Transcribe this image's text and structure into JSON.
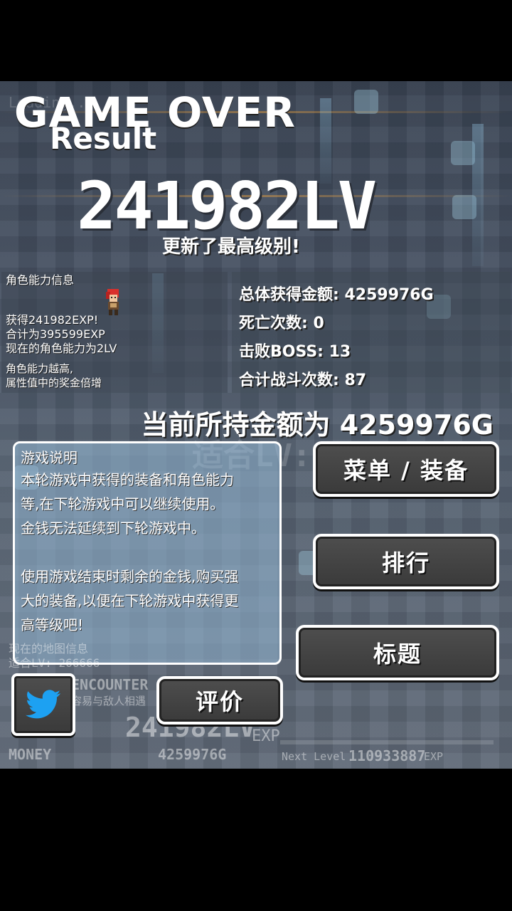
{
  "header": {
    "game_over": "GAME OVER",
    "result": "Result",
    "level": "241982LV",
    "level_message": "更新了最高级别!"
  },
  "character_panel": {
    "title": "角色能力信息",
    "lines": [
      "获得241982EXP!",
      "合计为395599EXP",
      "现在的角色能力为2LV"
    ],
    "note_lines": [
      "角色能力越高,",
      "属性值中的奖金倍增"
    ]
  },
  "stats": {
    "total_gold": "总体获得金额: 4259976G",
    "deaths": "死亡次数: 0",
    "bosses": "击败BOSS: 13",
    "battles": "合计战斗次数: 87"
  },
  "money_line": "当前所持金额为 4259976G",
  "info_box": {
    "title": "游戏说明",
    "lines": [
      "本轮游戏中获得的装备和角色能力",
      "等,在下轮游戏中可以继续使用。",
      "金钱无法延续到下轮游戏中。",
      "",
      "使用游戏结束时剩余的金钱,购买强",
      "大的装备,以便在下轮游戏中获得更",
      "高等级吧!"
    ]
  },
  "buttons": {
    "menu": "菜单 / 装备",
    "ranking": "排行",
    "title": "标题",
    "review": "评价"
  },
  "icons": {
    "twitter": "twitter-bird-icon",
    "twitter_color": "#1da1f2"
  },
  "hud": {
    "loading": "Loading...",
    "map_info": "现在的地图信息",
    "map_level": "适合LV: 266666",
    "gauge": "ENCOUNTER GAUGE",
    "gauge_sub": "容易与敌人相遇",
    "level": "241982LV",
    "exp": "EXP",
    "money_label": "MONEY",
    "money_value": "4259976G",
    "next_level": "Next Level",
    "next_value": "110933887",
    "next_unit": "EXP",
    "ghost_level": "适合LV: 266666"
  }
}
